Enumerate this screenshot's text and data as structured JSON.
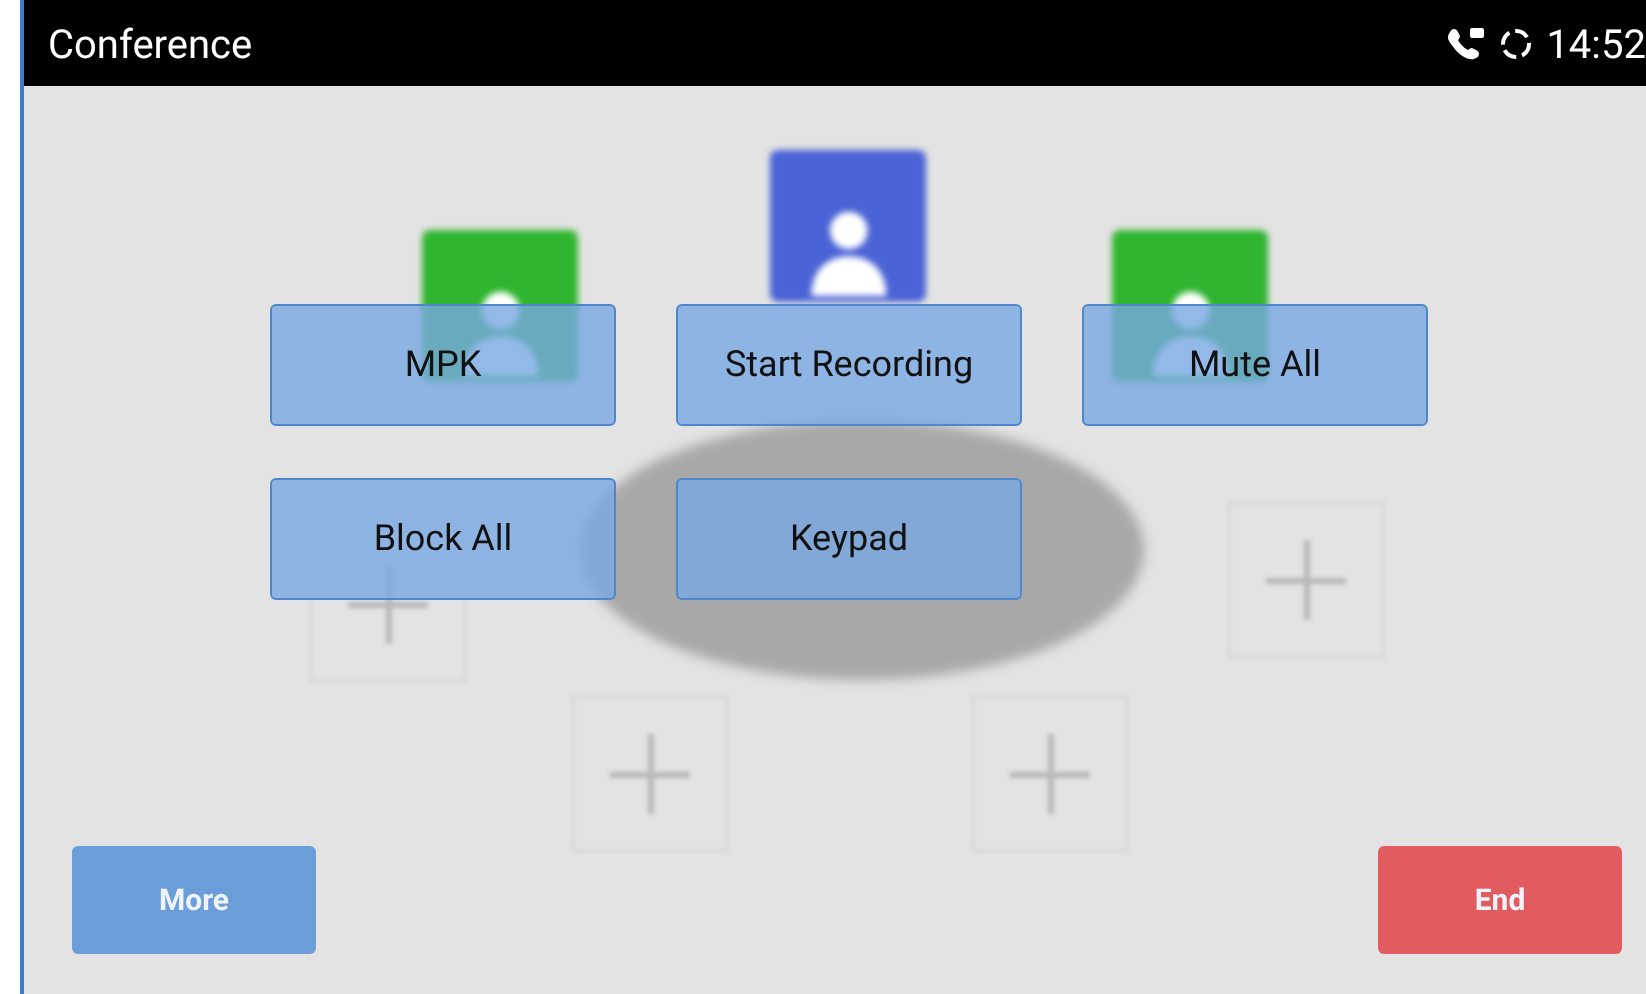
{
  "title_bar": {
    "title": "Conference",
    "time": "14:52"
  },
  "participants": [
    {
      "color": "#2fb52f"
    },
    {
      "color": "#4a63d6"
    },
    {
      "color": "#2fb52f"
    }
  ],
  "menu_buttons": [
    "MPK",
    "Start Recording",
    "Mute All",
    "Block All",
    "Keypad"
  ],
  "bottom_buttons": [
    {
      "kind": "more",
      "label": "More"
    },
    {
      "kind": "end",
      "label": "End"
    }
  ]
}
